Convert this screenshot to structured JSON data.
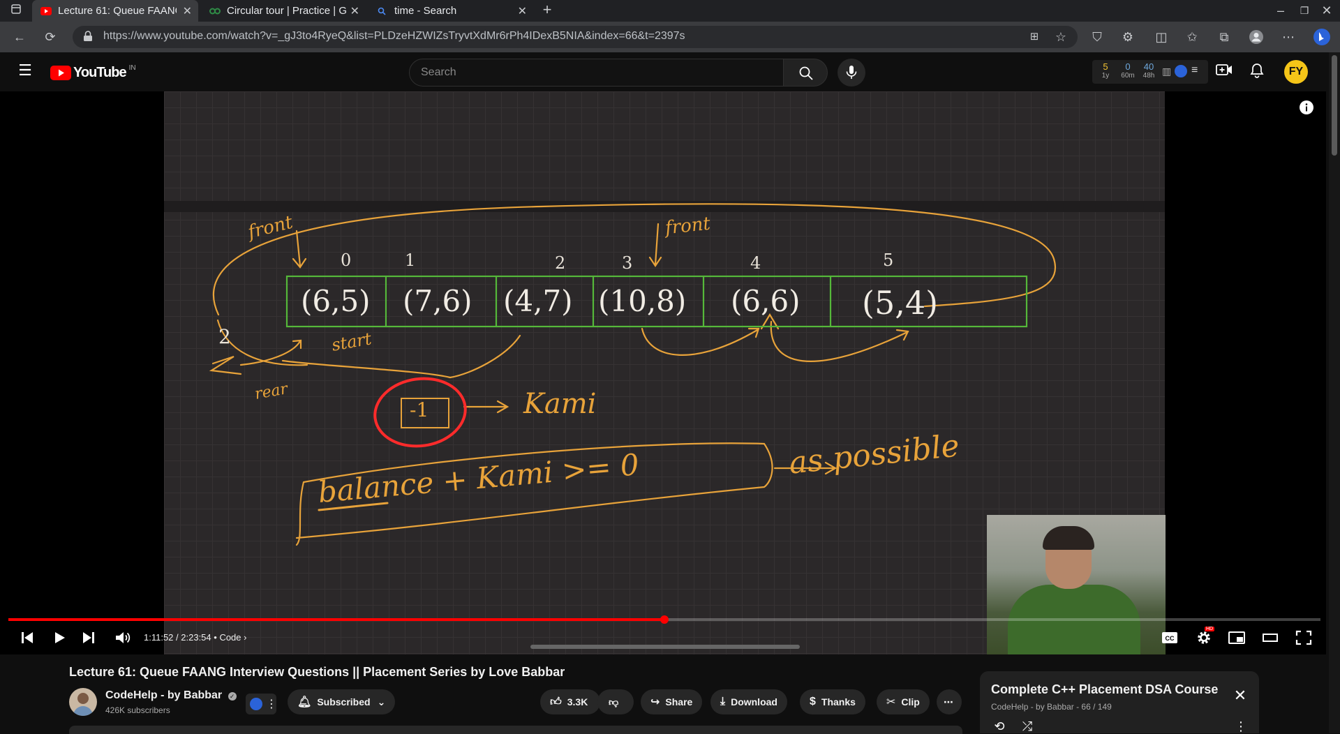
{
  "browser": {
    "tabs": [
      {
        "title": "Lecture 61: Queue FAANG",
        "active": true,
        "icon": "youtube-icon"
      },
      {
        "title": "Circular tour | Practice | G",
        "active": false,
        "icon": "gfg-icon"
      },
      {
        "title": "time - Search",
        "active": false,
        "icon": "search-icon"
      }
    ],
    "url": "https://www.youtube.com/watch?v=_gJ3to4RyeQ&list=PLDzeHZWIZsTryvtXdMr6rPh4IDexB5NIA&index=66&t=2397s"
  },
  "masthead": {
    "logo_text": "YouTube",
    "region": "IN",
    "search_placeholder": "Search",
    "stats": [
      {
        "value": "5",
        "label": "1y"
      },
      {
        "value": "0",
        "label": "60m"
      },
      {
        "value": "40",
        "label": "48h"
      }
    ],
    "avatar_initials": "FY"
  },
  "slide": {
    "labels": {
      "front_left": "front",
      "front_right": "front",
      "start": "start",
      "rear": "rear",
      "kami": "Kami",
      "condition": "balance + Kami >= 0",
      "as_possible": "as possible",
      "minus_one": "-1",
      "two": "2"
    },
    "indices": [
      "0",
      "1",
      "2",
      "3",
      "4",
      "5"
    ],
    "cells": [
      "(6,5)",
      "(7,6)",
      "(4,7)",
      "(10,8)",
      "(6,6)",
      "(5,4)"
    ]
  },
  "player": {
    "current_time": "1:11:52",
    "duration": "2:23:54",
    "chapter": "Code",
    "progress": 0.5,
    "hd_badge": "HD"
  },
  "video": {
    "title": "Lecture 61: Queue FAANG Interview Questions || Placement Series by Love Babbar",
    "channel": "CodeHelp - by Babbar",
    "subscribers": "426K subscribers",
    "subscribed_label": "Subscribed",
    "likes": "3.3K",
    "share_label": "Share",
    "download_label": "Download",
    "thanks_label": "Thanks",
    "clip_label": "Clip"
  },
  "playlist": {
    "title": "Complete C++ Placement DSA Course",
    "channel": "CodeHelp - by Babbar",
    "position": "66 / 149"
  }
}
